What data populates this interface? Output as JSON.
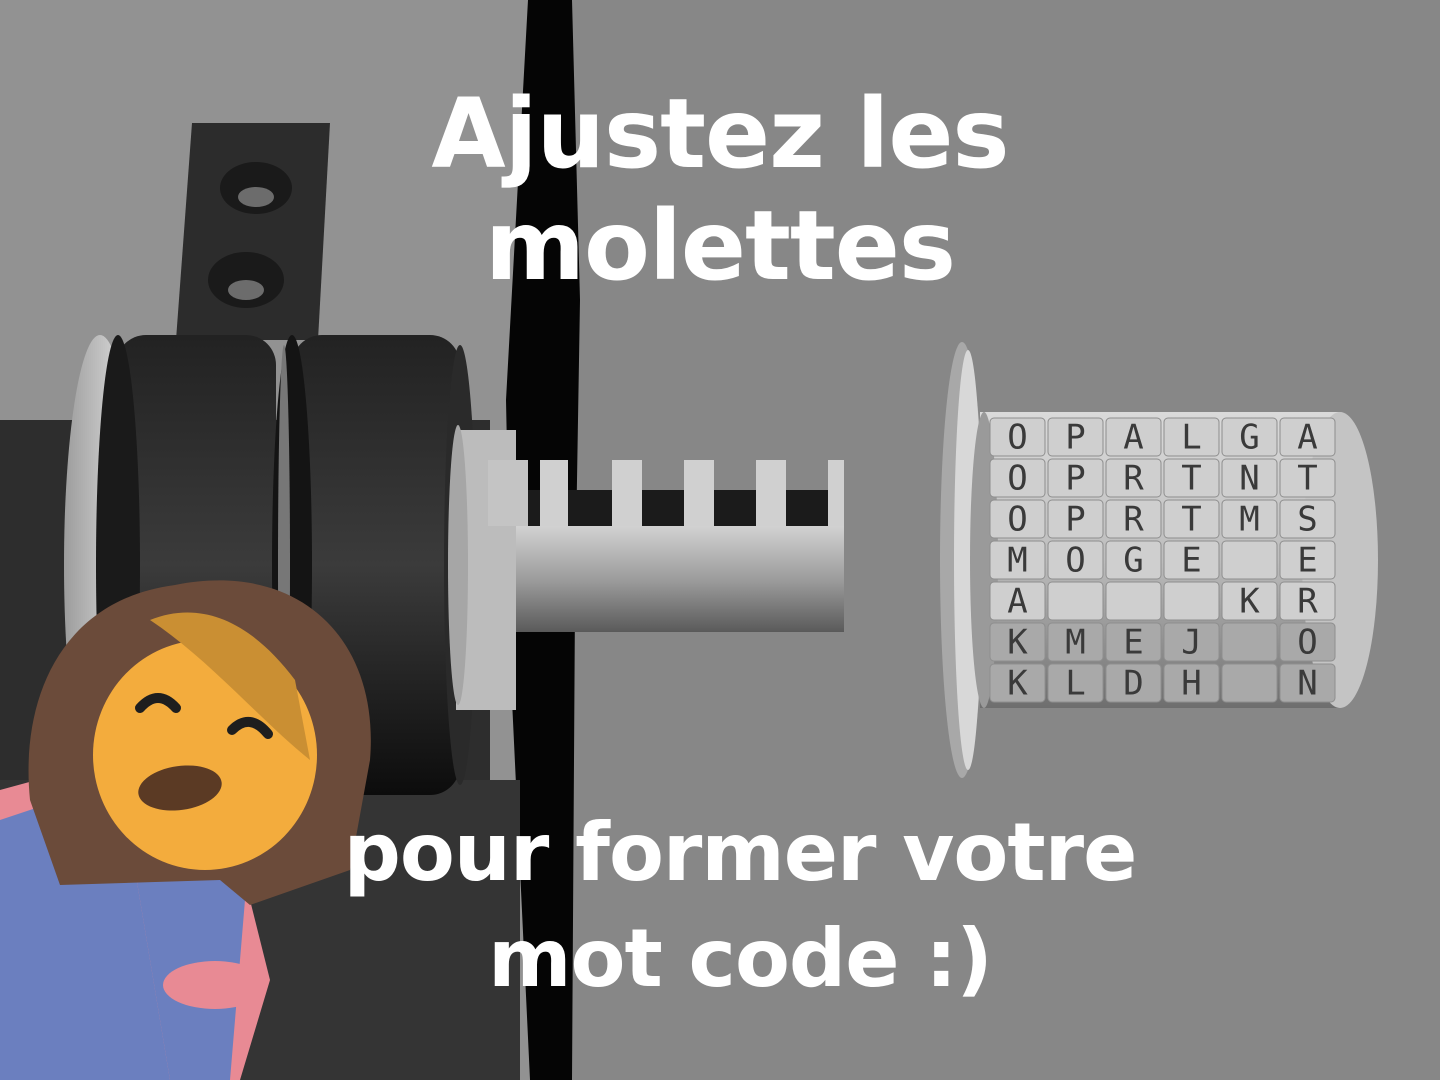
{
  "caption": {
    "top": {
      "line1": "Ajustez les",
      "line2": "molettes"
    },
    "bottom": {
      "line1": "pour former votre",
      "line2": "mot code :)"
    }
  },
  "cylinder_letters": [
    [
      "O",
      "P",
      "A",
      "L",
      "G",
      "A"
    ],
    [
      "O",
      "P",
      "R",
      "T",
      "N",
      "T"
    ],
    [
      "O",
      "P",
      "R",
      "T",
      "M",
      "S"
    ],
    [
      "M",
      "O",
      "G",
      "E",
      "",
      "E"
    ],
    [
      "A",
      "",
      "",
      "",
      "K",
      "R"
    ],
    [
      "K",
      "M",
      "E",
      "J",
      "",
      "O"
    ],
    [
      "K",
      "L",
      "D",
      "H",
      "",
      "N"
    ]
  ],
  "colors": {
    "background": "#8a8a8a",
    "lock_body": "#2f2f2f",
    "cylinder": "#c8c8c8",
    "character_hair": "#6b4b3a",
    "character_face": "#f3ac3d",
    "character_dress": "#6b7fbf",
    "character_shirt": "#e88a94"
  }
}
